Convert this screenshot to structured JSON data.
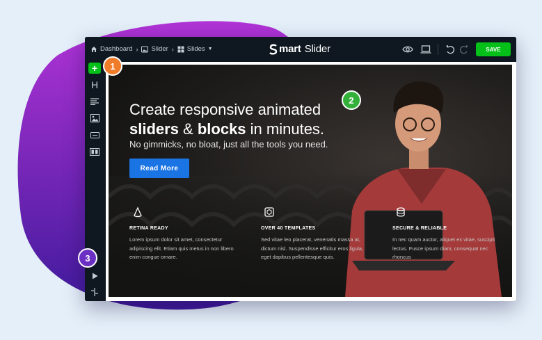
{
  "breadcrumbs": [
    {
      "label": "Dashboard",
      "icon": "home-icon"
    },
    {
      "label": "Slider",
      "icon": "image-icon"
    },
    {
      "label": "Slides",
      "icon": "grid-icon"
    }
  ],
  "brand": {
    "mark": "S",
    "name_bold": "mart",
    "name_light": "Slider"
  },
  "toolbar": {
    "save_label": "SAVE",
    "icons": [
      "eye-icon",
      "laptop-icon",
      "undo-icon",
      "redo-icon"
    ]
  },
  "sidebar": {
    "icons": [
      "add-icon",
      "heading-icon",
      "text-icon",
      "image-icon",
      "button-icon",
      "columns-icon",
      "play-icon",
      "layout-icon"
    ]
  },
  "slide": {
    "headline_line1": "Create responsive animated",
    "headline_bold1": "sliders",
    "headline_mid": " & ",
    "headline_bold2": "blocks",
    "headline_end": " in minutes.",
    "subheadline": "No gimmicks, no bloat, just all the tools you need.",
    "cta_label": "Read More",
    "features": [
      {
        "title": "RETINA READY",
        "text": "Lorem ipsum dolor sit amet, consectetur adipiscing elit. Etiam quis metus in non libero enim congue ornare.",
        "icon": "cone-icon"
      },
      {
        "title": "OVER 40 TEMPLATES",
        "text": "Sed vitae leo placerat, venenatis massa at, dictum nisl. Suspendisse efficitur eros ligula, eget dapibus pellentesque quis.",
        "icon": "cube-icon"
      },
      {
        "title": "SECURE & RELIABLE",
        "text": "In nec quam auctor, aliquet ex vitae, suscipit lectus. Fusce ipsum diam, consequat nec rhoncus",
        "icon": "database-icon"
      }
    ]
  },
  "badges": [
    {
      "number": "1",
      "color": "#f07c2a"
    },
    {
      "number": "2",
      "color": "#32b039"
    },
    {
      "number": "3",
      "color": "#6b2fc4"
    }
  ],
  "colors": {
    "accent": "#04c018",
    "cta": "#1b74e4",
    "blob_top": "#b133d6",
    "blob_bottom": "#3e1a9a"
  }
}
